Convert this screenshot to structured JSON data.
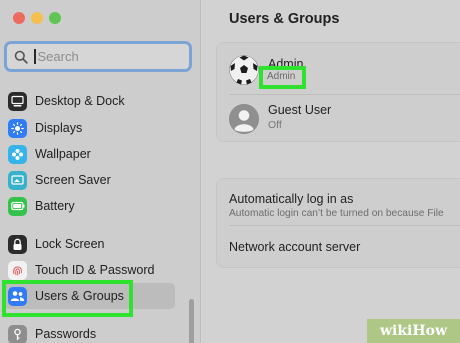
{
  "window": {
    "traffic_lights": [
      "#ed6a5e",
      "#f4bf4f",
      "#61c554"
    ]
  },
  "sidebar": {
    "search": {
      "placeholder": "Search",
      "value": ""
    },
    "items": [
      {
        "label": "Desktop & Dock",
        "icon": "desktop-dock-icon",
        "color": "#2b2b2b"
      },
      {
        "label": "Displays",
        "icon": "displays-icon",
        "color": "#2f7cf6"
      },
      {
        "label": "Wallpaper",
        "icon": "wallpaper-icon",
        "color": "#34b4e8"
      },
      {
        "label": "Screen Saver",
        "icon": "screen-saver-icon",
        "color": "#37b2c9"
      },
      {
        "label": "Battery",
        "icon": "battery-icon",
        "color": "#33c34a"
      },
      {
        "label": "Lock Screen",
        "icon": "lock-icon",
        "color": "#2b2b2b"
      },
      {
        "label": "Touch ID & Password",
        "icon": "fingerprint-icon",
        "color": "#f2f2f2"
      },
      {
        "label": "Users & Groups",
        "icon": "users-icon",
        "color": "#2f7cf6",
        "selected": true
      },
      {
        "label": "Passwords",
        "icon": "key-icon",
        "color": "#8e8e8e"
      }
    ]
  },
  "main": {
    "title": "Users & Groups",
    "users": [
      {
        "name": "Admin",
        "role": "Admin",
        "avatar": "soccer-ball-avatar"
      },
      {
        "name": "Guest User",
        "role": "Off",
        "avatar": "generic-user-avatar"
      }
    ],
    "auto_login": {
      "title": "Automatically log in as",
      "subtitle": "Automatic login can’t be turned on because File"
    },
    "network_server": {
      "title": "Network account server"
    }
  },
  "watermark": {
    "text": "wikiHow"
  },
  "highlight_color": "#2ee22e"
}
